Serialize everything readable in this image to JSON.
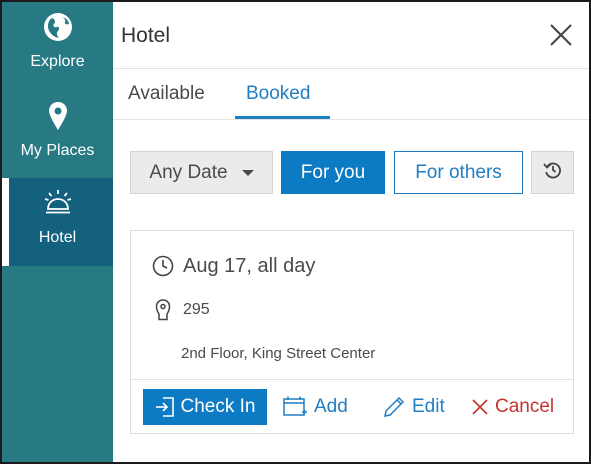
{
  "sidebar": {
    "items": [
      {
        "label": "Explore",
        "icon": "globe-icon"
      },
      {
        "label": "My Places",
        "icon": "map-pin-icon"
      },
      {
        "label": "Hotel",
        "icon": "hotel-bell-icon",
        "active": true
      }
    ]
  },
  "panel": {
    "title": "Hotel",
    "tabs": [
      {
        "label": "Available",
        "active": false
      },
      {
        "label": "Booked",
        "active": true
      }
    ],
    "filters": {
      "date_select": "Any Date",
      "for_you": "For you",
      "for_others": "For others"
    },
    "booking": {
      "date": "Aug 17, all day",
      "room": "295",
      "location": "2nd Floor, King Street Center",
      "actions": {
        "check_in": "Check In",
        "add": "Add",
        "edit": "Edit",
        "cancel": "Cancel"
      }
    }
  },
  "colors": {
    "sidebar_bg": "#277a84",
    "sidebar_active": "#13617d",
    "accent": "#0d7ac4",
    "danger": "#c8332b"
  }
}
